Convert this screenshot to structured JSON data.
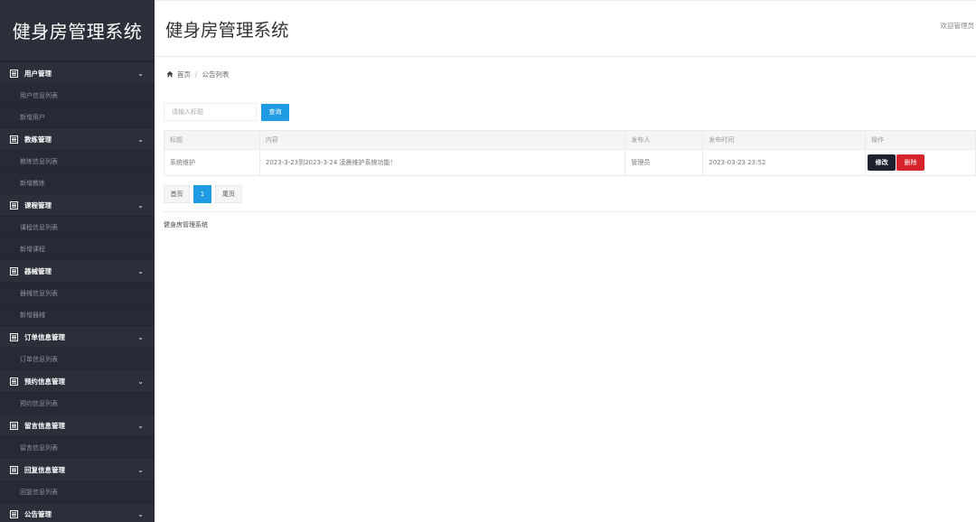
{
  "app": {
    "brand": "健身房管理系统",
    "page_title": "健身房管理系统",
    "welcome": "欢迎管理员"
  },
  "sidebar": {
    "groups": [
      {
        "label": "用户管理",
        "items": [
          "用户信息列表",
          "新增用户"
        ]
      },
      {
        "label": "教练管理",
        "items": [
          "教练信息列表",
          "新增教练"
        ]
      },
      {
        "label": "课程管理",
        "items": [
          "课程信息列表",
          "新增课程"
        ]
      },
      {
        "label": "器械管理",
        "items": [
          "器械信息列表",
          "新增器械"
        ]
      },
      {
        "label": "订单信息管理",
        "items": [
          "订单信息列表"
        ]
      },
      {
        "label": "预约信息管理",
        "items": [
          "预约信息列表"
        ]
      },
      {
        "label": "留言信息管理",
        "items": [
          "留言信息列表"
        ]
      },
      {
        "label": "回复信息管理",
        "items": [
          "回复信息列表"
        ]
      },
      {
        "label": "公告管理",
        "items": []
      }
    ]
  },
  "breadcrumb": {
    "home": "首页",
    "separator": "/",
    "current": "公告列表"
  },
  "search": {
    "placeholder": "请输入标题",
    "value": "",
    "button": "查询"
  },
  "table": {
    "headers": [
      "标题",
      "内容",
      "发布人",
      "发布时间",
      "操作"
    ],
    "rows": [
      {
        "title": "系统维护",
        "content": "2023-3-23到2023-3-24 凌晨维护系统功能！",
        "publisher": "管理员",
        "time": "2023-03-23 23:52",
        "edit": "修改",
        "delete": "删除"
      }
    ]
  },
  "pager": {
    "first": "首页",
    "current": "1",
    "last": "尾页"
  },
  "footer": {
    "text": "健身房管理系统"
  },
  "colors": {
    "sidebar_bg": "#2b2f3a",
    "primary": "#1f9be3",
    "danger": "#d8232a",
    "dark_button": "#1e2230"
  },
  "icons": {
    "menu_group": "list-icon",
    "menu_chevron": "chevron-down-icon",
    "breadcrumb_home": "home-icon"
  }
}
